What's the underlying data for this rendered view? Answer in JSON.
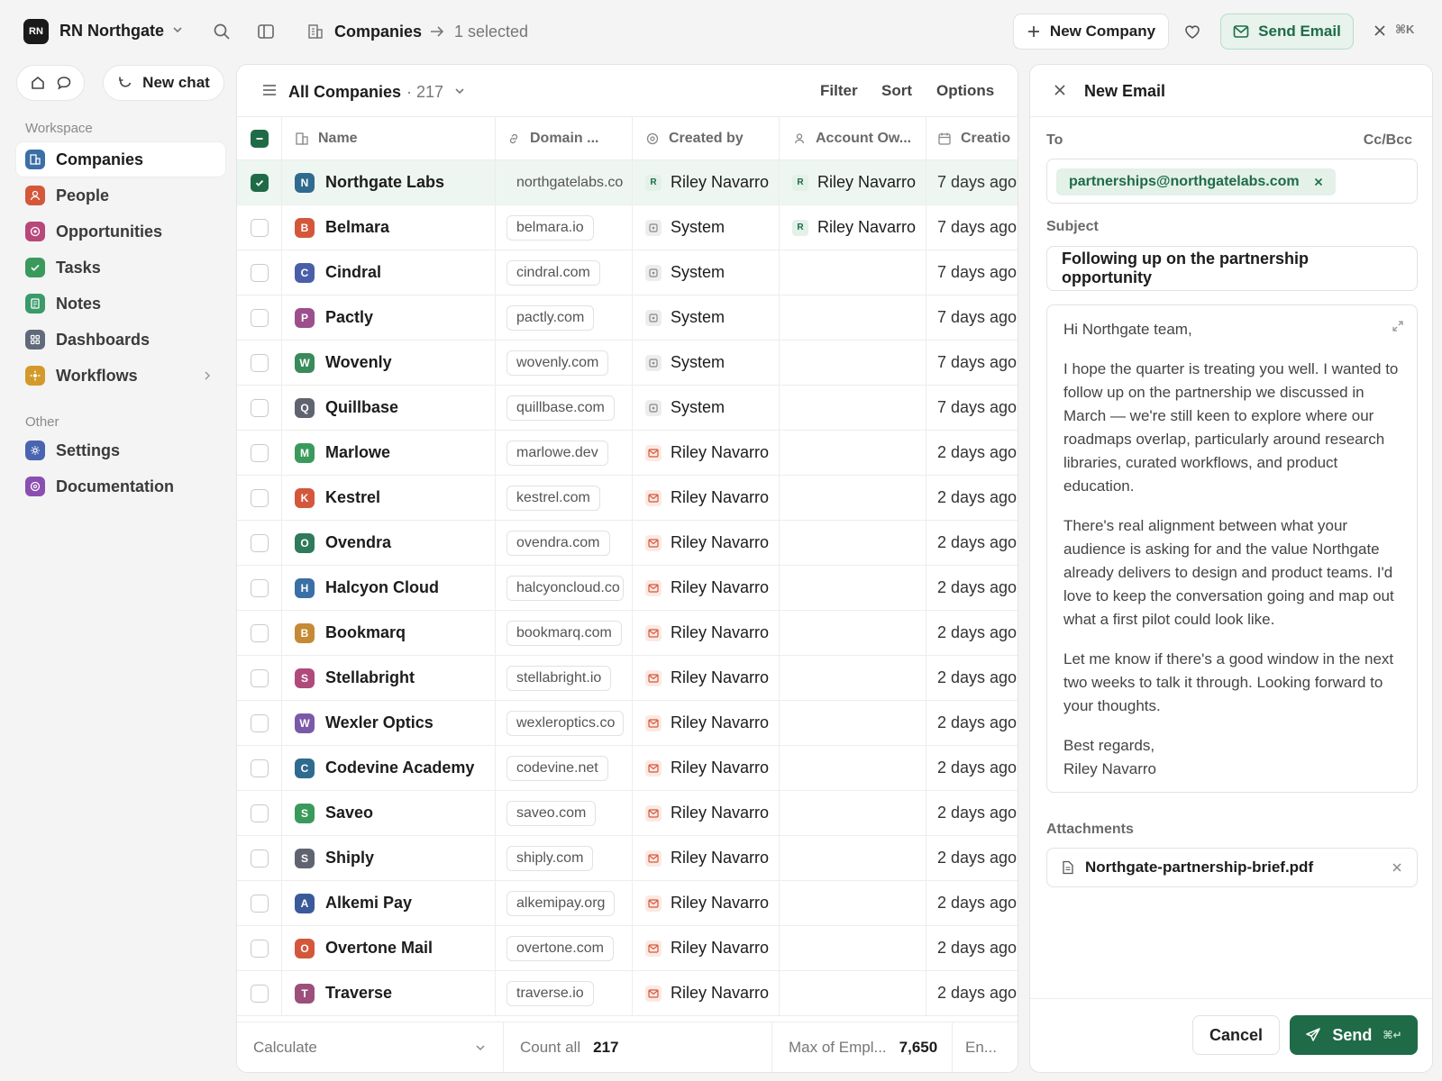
{
  "workspace": {
    "initials": "RN",
    "name": "RN Northgate"
  },
  "breadcrumb": {
    "title": "Companies",
    "selection": "1 selected"
  },
  "header": {
    "new_company": "New Company",
    "send_email": "Send Email",
    "shortcut": "⌘K"
  },
  "sidebar": {
    "new_chat": "New chat",
    "workspace_label": "Workspace",
    "items": [
      {
        "label": "Companies",
        "icon": "building-icon",
        "color": "#3b6fa6"
      },
      {
        "label": "People",
        "icon": "person-icon",
        "color": "#d4573b"
      },
      {
        "label": "Opportunities",
        "icon": "target-icon",
        "color": "#b8477a"
      },
      {
        "label": "Tasks",
        "icon": "check-icon",
        "color": "#3a9a5c"
      },
      {
        "label": "Notes",
        "icon": "note-icon",
        "color": "#3a9a6a"
      },
      {
        "label": "Dashboards",
        "icon": "grid-icon",
        "color": "#5f6b7a"
      },
      {
        "label": "Workflows",
        "icon": "workflow-icon",
        "color": "#d39a2b"
      }
    ],
    "other_label": "Other",
    "other_items": [
      {
        "label": "Settings",
        "icon": "gear-icon",
        "color": "#4a64b0"
      },
      {
        "label": "Documentation",
        "icon": "help-icon",
        "color": "#8a4fb0"
      }
    ]
  },
  "view": {
    "title": "All Companies",
    "count": "· 217",
    "filter": "Filter",
    "sort": "Sort",
    "options": "Options"
  },
  "table": {
    "columns": {
      "name": "Name",
      "domain": "Domain ...",
      "created_by": "Created by",
      "owner": "Account Ow...",
      "created": "Creatio"
    },
    "rows": [
      {
        "initial": "N",
        "color": "#2f6a8f",
        "name": "Northgate Labs",
        "domain": "northgatelabs.co",
        "source": "user",
        "source_initial": "R",
        "created_by": "Riley Navarro",
        "owner_initial": "R",
        "owner": "Riley Navarro",
        "date": "7 days ago",
        "selected": true
      },
      {
        "initial": "B",
        "color": "#d4573b",
        "name": "Belmara",
        "domain": "belmara.io",
        "source": "sys",
        "created_by": "System",
        "owner_initial": "R",
        "owner": "Riley Navarro",
        "date": "7 days ago"
      },
      {
        "initial": "C",
        "color": "#4a5fa8",
        "name": "Cindral",
        "domain": "cindral.com",
        "source": "sys",
        "created_by": "System",
        "owner": "",
        "date": "7 days ago"
      },
      {
        "initial": "P",
        "color": "#9c4f8c",
        "name": "Pactly",
        "domain": "pactly.com",
        "source": "sys",
        "created_by": "System",
        "owner": "",
        "date": "7 days ago"
      },
      {
        "initial": "W",
        "color": "#3a8a5c",
        "name": "Wovenly",
        "domain": "wovenly.com",
        "source": "sys",
        "created_by": "System",
        "owner": "",
        "date": "7 days ago"
      },
      {
        "initial": "Q",
        "color": "#5f6470",
        "name": "Quillbase",
        "domain": "quillbase.com",
        "source": "sys",
        "created_by": "System",
        "owner": "",
        "date": "7 days ago"
      },
      {
        "initial": "M",
        "color": "#3a9a5c",
        "name": "Marlowe",
        "domain": "marlowe.dev",
        "source": "mail",
        "created_by": "Riley Navarro",
        "owner": "",
        "date": "2 days ago"
      },
      {
        "initial": "K",
        "color": "#d4573b",
        "name": "Kestrel",
        "domain": "kestrel.com",
        "source": "mail",
        "created_by": "Riley Navarro",
        "owner": "",
        "date": "2 days ago"
      },
      {
        "initial": "O",
        "color": "#2f7a5a",
        "name": "Ovendra",
        "domain": "ovendra.com",
        "source": "mail",
        "created_by": "Riley Navarro",
        "owner": "",
        "date": "2 days ago"
      },
      {
        "initial": "H",
        "color": "#3b6fa6",
        "name": "Halcyon Cloud",
        "domain": "halcyoncloud.co",
        "source": "mail",
        "created_by": "Riley Navarro",
        "owner": "",
        "date": "2 days ago"
      },
      {
        "initial": "B",
        "color": "#c58a35",
        "name": "Bookmarq",
        "domain": "bookmarq.com",
        "source": "mail",
        "created_by": "Riley Navarro",
        "owner": "",
        "date": "2 days ago"
      },
      {
        "initial": "S",
        "color": "#b04a7a",
        "name": "Stellabright",
        "domain": "stellabright.io",
        "source": "mail",
        "created_by": "Riley Navarro",
        "owner": "",
        "date": "2 days ago"
      },
      {
        "initial": "W",
        "color": "#7a5aa8",
        "name": "Wexler Optics",
        "domain": "wexleroptics.co",
        "source": "mail",
        "created_by": "Riley Navarro",
        "owner": "",
        "date": "2 days ago"
      },
      {
        "initial": "C",
        "color": "#2f6a8f",
        "name": "Codevine Academy",
        "domain": "codevine.net",
        "source": "mail",
        "created_by": "Riley Navarro",
        "owner": "",
        "date": "2 days ago"
      },
      {
        "initial": "S",
        "color": "#3a9a5c",
        "name": "Saveo",
        "domain": "saveo.com",
        "source": "mail",
        "created_by": "Riley Navarro",
        "owner": "",
        "date": "2 days ago"
      },
      {
        "initial": "S",
        "color": "#5f6470",
        "name": "Shiply",
        "domain": "shiply.com",
        "source": "mail",
        "created_by": "Riley Navarro",
        "owner": "",
        "date": "2 days ago"
      },
      {
        "initial": "A",
        "color": "#3b5a9a",
        "name": "Alkemi Pay",
        "domain": "alkemipay.org",
        "source": "mail",
        "created_by": "Riley Navarro",
        "owner": "",
        "date": "2 days ago"
      },
      {
        "initial": "O",
        "color": "#d4573b",
        "name": "Overtone Mail",
        "domain": "overtone.com",
        "source": "mail",
        "created_by": "Riley Navarro",
        "owner": "",
        "date": "2 days ago"
      },
      {
        "initial": "T",
        "color": "#9c4f7a",
        "name": "Traverse",
        "domain": "traverse.io",
        "source": "mail",
        "created_by": "Riley Navarro",
        "owner": "",
        "date": "2 days ago"
      }
    ]
  },
  "footer": {
    "calculate": "Calculate",
    "count_label": "Count all",
    "count_value": "217",
    "max_label": "Max of Empl...",
    "max_value": "7,650",
    "extra": "En..."
  },
  "email": {
    "title": "New Email",
    "to_label": "To",
    "ccbcc": "Cc/Bcc",
    "recipient": "partnerships@northgatelabs.com",
    "subject_label": "Subject",
    "subject": "Following up on the partnership opportunity",
    "body": [
      "Hi Northgate team,",
      "I hope the quarter is treating you well. I wanted to follow up on the partnership we discussed in March — we're still keen to explore where our roadmaps overlap, particularly around research libraries, curated workflows, and product education.",
      "There's real alignment between what your audience is asking for and the value Northgate already delivers to design and product teams. I'd love to keep the conversation going and map out what a first pilot could look like.",
      "Let me know if there's a good window in the next two weeks to talk it through. Looking forward to your thoughts.",
      "Best regards,\nRiley Navarro"
    ],
    "attachments_label": "Attachments",
    "attachment": "Northgate-partnership-brief.pdf",
    "cancel": "Cancel",
    "send": "Send",
    "send_shortcut": "⌘↵"
  }
}
